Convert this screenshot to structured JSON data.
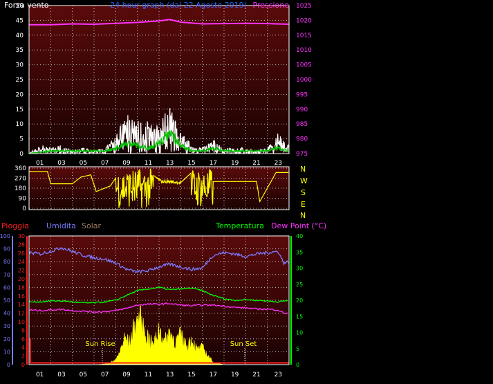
{
  "top_chart": {
    "title": "24 hour graph (dal 22 Agosto 2019)",
    "left_label": "Forza vento",
    "right_label": "Pressione",
    "colors": {
      "wind": "#ffffff",
      "gust": "#ffffff",
      "avg": "#00c000",
      "pressure": "#ff33ff",
      "left_axis": "#ffffff",
      "right_axis": "#ff33ff",
      "title": "#3366ff"
    }
  },
  "direction_chart": {
    "compass": [
      "N",
      "W",
      "S",
      "E",
      "N"
    ],
    "color": "#ffff00"
  },
  "bottom_chart": {
    "labels": {
      "pioggia": "Pioggia",
      "umidita": "Umidita",
      "solar": "Solar",
      "temperatura": "Temperatura",
      "dewpoint": "Dew Point (°C)"
    },
    "annotations": {
      "sunrise": "Sun Rise",
      "sunset": "Sun Set"
    },
    "colors": {
      "rain": "#ff2020",
      "humidity": "#7b7bff",
      "solar": "#ffff00",
      "temperature": "#00ff00",
      "dewpoint": "#ff33ff",
      "solar_axis": "#a08060"
    }
  },
  "chart_data": [
    {
      "type": "line",
      "title": "24 hour graph (dal 22 Agosto 2019)",
      "x_ticks": [
        "01",
        "03",
        "05",
        "07",
        "09",
        "11",
        "13",
        "15",
        "17",
        "19",
        "21",
        "23"
      ],
      "y_left": {
        "label": "Forza vento",
        "ylim": [
          0,
          50
        ],
        "ticks": [
          0,
          5,
          10,
          15,
          20,
          25,
          30,
          35,
          40,
          45,
          50
        ]
      },
      "y_right": {
        "label": "Pressione",
        "ylim": [
          975,
          1025
        ],
        "ticks": [
          975,
          980,
          985,
          990,
          995,
          1000,
          1005,
          1010,
          1015,
          1020,
          1025
        ]
      },
      "series": [
        {
          "axis": "right",
          "x": [
            0,
            2,
            4,
            6,
            8,
            10,
            12,
            13,
            14,
            16,
            18,
            20,
            22,
            24
          ],
          "values": [
            1018.5,
            1018.5,
            1018.8,
            1018.7,
            1019,
            1019.3,
            1019.8,
            1020.3,
            1019.4,
            1018.8,
            1018.9,
            1019,
            1018.9,
            1018.7
          ]
        },
        {
          "axis": "left",
          "x": [
            0,
            1,
            2,
            3,
            4,
            5,
            6,
            7,
            8,
            9,
            10,
            11,
            12,
            13,
            14,
            15,
            16,
            17,
            18,
            19,
            20,
            21,
            22,
            23,
            24
          ],
          "values": [
            0,
            3,
            2,
            3,
            1,
            2,
            1,
            2,
            6,
            15,
            12,
            11,
            10,
            17,
            8,
            3,
            2,
            5,
            2,
            2,
            2,
            1,
            2,
            7,
            3
          ]
        },
        {
          "axis": "left",
          "x": [
            0,
            2,
            4,
            6,
            7,
            8,
            9,
            10,
            11,
            12,
            13,
            14,
            15,
            16,
            17,
            18,
            20,
            22,
            23,
            24
          ],
          "values": [
            0,
            1,
            1,
            1,
            1,
            2,
            4,
            3,
            2,
            4,
            8,
            3,
            1,
            1,
            2,
            1,
            1,
            1,
            2,
            1
          ]
        }
      ]
    },
    {
      "type": "line",
      "x_ticks": [
        "01",
        "03",
        "05",
        "07",
        "09",
        "11",
        "13",
        "15",
        "17",
        "19",
        "21",
        "23"
      ],
      "y": {
        "ylim": [
          0,
          360
        ],
        "ticks": [
          0,
          90,
          180,
          270,
          360
        ]
      },
      "series": [
        {
          "x": [
            0,
            1.7,
            2,
            4,
            4.8,
            5.7,
            6.2,
            7.5,
            8.2,
            9,
            10,
            11.3,
            12.2,
            12.8,
            14,
            15,
            16.3,
            17,
            18.3,
            21,
            21.3,
            22.8,
            24
          ],
          "values": [
            330,
            330,
            220,
            220,
            280,
            300,
            150,
            200,
            300,
            320,
            250,
            310,
            240,
            240,
            230,
            320,
            80,
            240,
            240,
            240,
            60,
            320,
            320
          ]
        }
      ]
    },
    {
      "type": "line",
      "x_ticks": [
        "01",
        "03",
        "05",
        "07",
        "09",
        "11",
        "13",
        "15",
        "17",
        "19",
        "21",
        "23"
      ],
      "axes": {
        "humidity": {
          "ylim": [
            0,
            100
          ],
          "ticks": [
            0,
            10,
            20,
            30,
            40,
            50,
            60,
            70,
            80,
            90,
            100
          ]
        },
        "rain": {
          "ylim": [
            0,
            30
          ],
          "ticks": [
            0,
            2,
            4,
            6,
            8,
            10,
            12,
            14,
            16,
            18,
            20,
            22,
            24,
            26,
            28,
            30
          ]
        },
        "temperature": {
          "ylim": [
            0,
            40
          ],
          "ticks": [
            0,
            5,
            10,
            15,
            20,
            25,
            30,
            35,
            40
          ]
        }
      },
      "series": [
        {
          "name": "Umidita",
          "axis": "humidity",
          "x": [
            0,
            1,
            2,
            3,
            4,
            5,
            6,
            7,
            8,
            9,
            10,
            11,
            12,
            13,
            14,
            15,
            16,
            17,
            18,
            19,
            20,
            21,
            22,
            23,
            23.5,
            24
          ],
          "values": [
            87,
            86,
            88,
            91,
            88,
            85,
            83,
            82,
            79,
            74,
            72,
            73,
            76,
            78,
            76,
            74,
            75,
            85,
            87,
            86,
            84,
            86,
            87,
            88,
            79,
            80
          ]
        },
        {
          "name": "Temperatura",
          "axis": "temperature",
          "x": [
            0,
            1,
            2,
            3,
            4,
            5,
            6,
            7,
            8,
            9,
            10,
            11,
            12,
            13,
            14,
            15,
            16,
            17,
            18,
            19,
            20,
            21,
            22,
            23,
            24
          ],
          "values": [
            19.5,
            19.5,
            19.8,
            19.8,
            19.5,
            19.2,
            19.2,
            19.5,
            20,
            21.5,
            23,
            23.5,
            24,
            23.3,
            23.5,
            23.8,
            23,
            21.5,
            20.5,
            20,
            20.2,
            20,
            19.8,
            19.5,
            20
          ]
        },
        {
          "name": "Dew Point (°C)",
          "axis": "temperature",
          "x": [
            0,
            1,
            2,
            3,
            4,
            5,
            6,
            7,
            8,
            9,
            10,
            11,
            12,
            13,
            14,
            15,
            16,
            17,
            18,
            19,
            20,
            21,
            22,
            23,
            23.5,
            24
          ],
          "values": [
            17,
            16.8,
            17,
            17.2,
            16.8,
            16.6,
            16.4,
            16.5,
            16.8,
            17.5,
            18.5,
            18.8,
            18.8,
            19,
            18.5,
            18.3,
            18.5,
            18.5,
            18.2,
            17.8,
            17.6,
            17.3,
            17.2,
            17,
            16,
            16
          ]
        },
        {
          "name": "Solar",
          "axis": "rain",
          "x": [
            0,
            5,
            6.3,
            7.2,
            7.7,
            8.2,
            8.8,
            9.3,
            9.7,
            10.2,
            10.6,
            11,
            11.5,
            12,
            12.5,
            13,
            13.5,
            14,
            14.5,
            15,
            15.5,
            16,
            16.6,
            17.1,
            17.4,
            18,
            20,
            24
          ],
          "values": [
            0,
            0,
            0,
            0.2,
            0.8,
            2,
            7,
            6,
            10,
            13,
            9,
            7.5,
            5,
            10,
            6,
            9,
            6,
            8,
            5,
            7,
            4,
            4.5,
            2,
            0.5,
            0.3,
            0,
            0,
            0
          ]
        },
        {
          "name": "Pioggia",
          "axis": "rain",
          "x": [
            0,
            0.1,
            0.12,
            24
          ],
          "values": [
            6,
            6,
            0.4,
            0.4
          ]
        }
      ]
    }
  ]
}
